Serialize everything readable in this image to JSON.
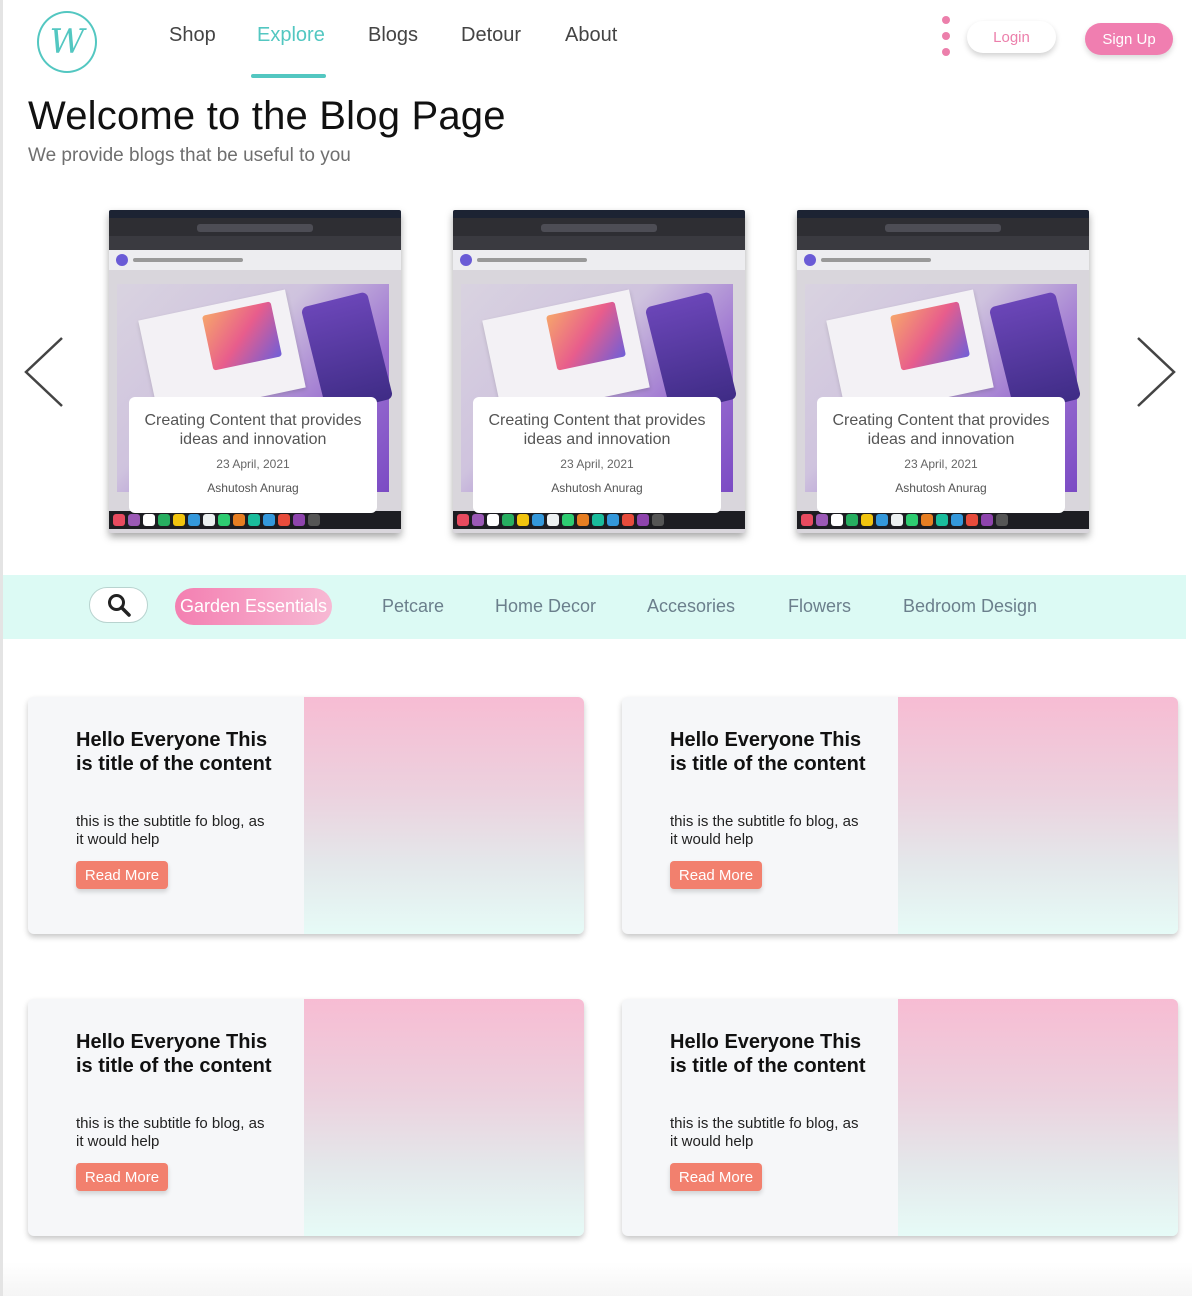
{
  "header": {
    "logo_letter": "W",
    "nav": [
      {
        "label": "Shop",
        "active": false
      },
      {
        "label": "Explore",
        "active": true
      },
      {
        "label": "Blogs",
        "active": false
      },
      {
        "label": "Detour",
        "active": false
      },
      {
        "label": "About",
        "active": false
      }
    ],
    "login_label": "Login",
    "signup_label": "Sign Up"
  },
  "hero": {
    "title": "Welcome to the Blog Page",
    "subtitle": "We provide blogs that be useful to you"
  },
  "carousel": {
    "items": [
      {
        "title": "Creating Content that provides ideas and innovation",
        "date": "23 April, 2021",
        "author": "Ashutosh Anurag"
      },
      {
        "title": "Creating Content that provides ideas and innovation",
        "date": "23 April, 2021",
        "author": "Ashutosh Anurag"
      },
      {
        "title": "Creating Content that provides ideas and innovation",
        "date": "23 April, 2021",
        "author": "Ashutosh Anurag"
      }
    ]
  },
  "categories": {
    "items": [
      {
        "label": "Garden Essentials",
        "active": true
      },
      {
        "label": "Petcare",
        "active": false
      },
      {
        "label": "Home Decor",
        "active": false
      },
      {
        "label": "Accesories",
        "active": false
      },
      {
        "label": "Flowers",
        "active": false
      },
      {
        "label": "Bedroom Design",
        "active": false
      }
    ]
  },
  "posts": [
    {
      "title": "Hello Everyone This is title of the content",
      "subtitle": "this is the subtitle fo blog, as it would help",
      "button": "Read More"
    },
    {
      "title": "Hello Everyone This is title of the content",
      "subtitle": "this is the subtitle fo blog, as it would help",
      "button": "Read More"
    },
    {
      "title": "Hello Everyone This is title of the content",
      "subtitle": "this is the subtitle fo blog, as it would help",
      "button": "Read More"
    },
    {
      "title": "Hello Everyone This is title of the content",
      "subtitle": "this is the subtitle fo blog, as it would help",
      "button": "Read More"
    }
  ],
  "colors": {
    "accent_teal": "#53c7c1",
    "accent_pink": "#f07eb0",
    "button_coral": "#f2806e",
    "category_bar": "#dcfaf4"
  },
  "icons": [
    "logo-mark",
    "kebab-menu-icon",
    "chevron-left-icon",
    "chevron-right-icon",
    "search-icon"
  ]
}
